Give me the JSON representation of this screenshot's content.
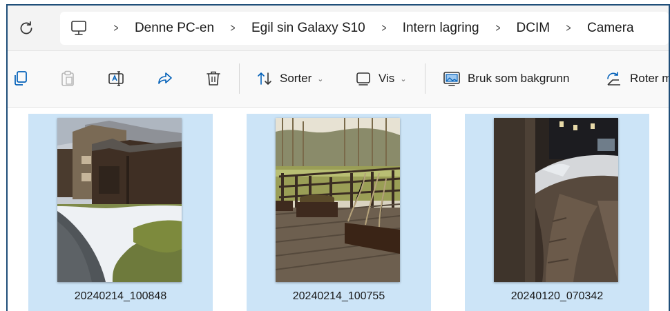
{
  "address_bar": {
    "breadcrumbs": [
      "Denne PC-en",
      "Egil sin Galaxy S10",
      "Intern lagring",
      "DCIM",
      "Camera"
    ],
    "separator": ">"
  },
  "toolbar": {
    "sort_label": "Sorter",
    "view_label": "Vis",
    "set_background_label": "Bruk som bakgrunn",
    "rotate_label": "Roter m"
  },
  "files": [
    {
      "name": "20240214_100848",
      "scene": "apartment-building-snow"
    },
    {
      "name": "20240214_100755",
      "scene": "wooden-deck-railing"
    },
    {
      "name": "20240120_070342",
      "scene": "snow-path-night"
    }
  ],
  "colors": {
    "selection": "#cce4f7",
    "accent": "#005fb8",
    "frame_border": "#1f4e79"
  }
}
